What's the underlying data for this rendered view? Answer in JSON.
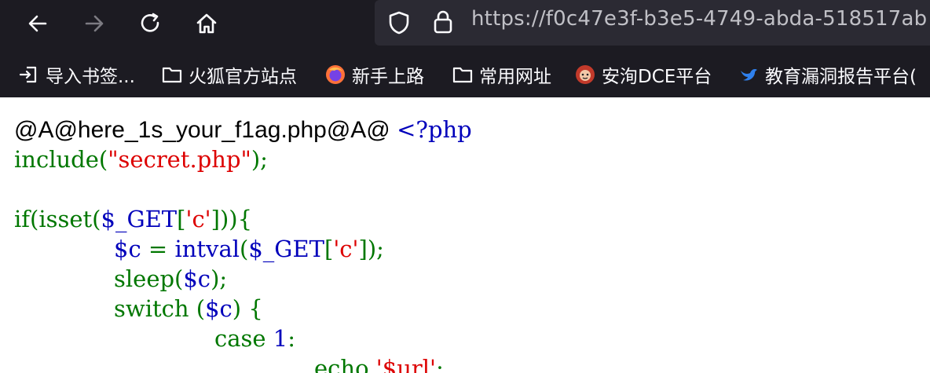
{
  "browser": {
    "url": "https://f0c47e3f-b3e5-4749-abda-518517ab",
    "bookmarks": [
      {
        "label": "导入书签...",
        "icon": "import-icon"
      },
      {
        "label": "火狐官方站点",
        "icon": "folder-icon"
      },
      {
        "label": "新手上路",
        "icon": "firefox-icon"
      },
      {
        "label": "常用网址",
        "icon": "folder-icon"
      },
      {
        "label": "安洵DCE平台",
        "icon": "monkey-icon"
      },
      {
        "label": "教育漏洞报告平台(",
        "icon": "bird-icon"
      }
    ]
  },
  "colors": {
    "php_default": "#0000BB",
    "php_keyword": "#007700",
    "php_string": "#DD0000",
    "chrome_bg": "#1c1b22",
    "urlbar_bg": "#2b2a33"
  },
  "page": {
    "heading": "@A@here_1s_your_f1ag.php@A@ ",
    "code": {
      "open_tag": "<?php",
      "l2_include": "include(",
      "l2_string": "\"secret.php\"",
      "l2_end": ");",
      "l4_a": "if(isset(",
      "l4_b": "$_GET",
      "l4_c": "[",
      "l4_d": "'c'",
      "l4_e": "])){",
      "l5_a": "$c",
      "l5_b": " = ",
      "l5_c": "intval",
      "l5_d": "(",
      "l5_e": "$_GET",
      "l5_f": "[",
      "l5_g": "'c'",
      "l5_h": "]);",
      "l6_a": "sleep(",
      "l6_b": "$c",
      "l6_c": ");",
      "l7_a": "switch (",
      "l7_b": "$c",
      "l7_c": ") {",
      "l8_a": "case ",
      "l8_b": "1",
      "l8_c": ":",
      "l9_a": "echo ",
      "l9_b": "'$url'",
      "l9_c": ";"
    }
  }
}
